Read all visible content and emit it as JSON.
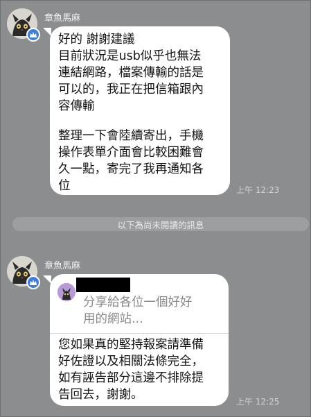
{
  "message1": {
    "sender": "章魚馬麻",
    "lines": [
      "好的 謝謝建議",
      "目前狀況是usb似乎也無法",
      "連結網路，檔案傳輸的話是",
      "可以的，我正在把信箱跟內",
      "容傳輸",
      "",
      "整理一下會陸續寄出，手機",
      "操作表單介面會比較困難會",
      "久一點，寄完了我再通知各",
      "位"
    ],
    "time": "上午 12:23"
  },
  "divider": {
    "label": "以下為尚未閱讀的訊息"
  },
  "message2": {
    "sender": "章魚馬麻",
    "share_lines": [
      "分享給各位一個好好",
      "用的網站..."
    ],
    "body_lines": [
      "您如果真的堅持報案請準備",
      "好佐證以及相關法條完全，",
      "如有誣告部分這邊不排除提",
      "告回去，謝謝。"
    ],
    "time": "上午 12:25"
  },
  "colors": {
    "background": "#8b8d8e",
    "bubble": "#ffffff",
    "badge": "#3b7de0"
  },
  "icons": {
    "badge": "crown-icon",
    "avatar": "octopus-cat-avatar"
  }
}
